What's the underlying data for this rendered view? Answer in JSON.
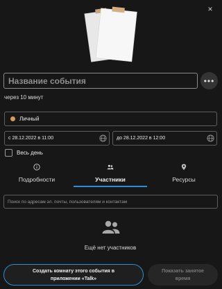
{
  "dialog": {
    "close_glyph": "×",
    "illustration_icon": "paper-sheets-illustration",
    "title_placeholder": "Название события",
    "more_glyph": "•••",
    "timing_text": "через 10 минут"
  },
  "calendar": {
    "label": "Личный",
    "color": "#d49b5a"
  },
  "dates": {
    "start": "с 28.12.2022 в 11:00",
    "end": "до 28.12.2022 в 12:00",
    "timezone_icon": "globe-icon"
  },
  "all_day": {
    "label": "Весь день",
    "checked": false
  },
  "tabs": [
    {
      "label": "Подробности",
      "icon": "info-icon",
      "active": false
    },
    {
      "label": "Участники",
      "icon": "people-icon",
      "active": true
    },
    {
      "label": "Ресурсы",
      "icon": "location-pin-icon",
      "active": false
    }
  ],
  "attendees": {
    "search_placeholder": "Поиск по адресам эл. почты, пользователям и контактам",
    "empty_icon": "people-icon",
    "empty_text": "Ещё нет участников"
  },
  "actions": {
    "talk_label": "Создать комнату этого события в приложении «Talk»",
    "busy_label": "Показать занятое время"
  },
  "colors": {
    "accent": "#2a8fd8",
    "background": "#171717"
  }
}
